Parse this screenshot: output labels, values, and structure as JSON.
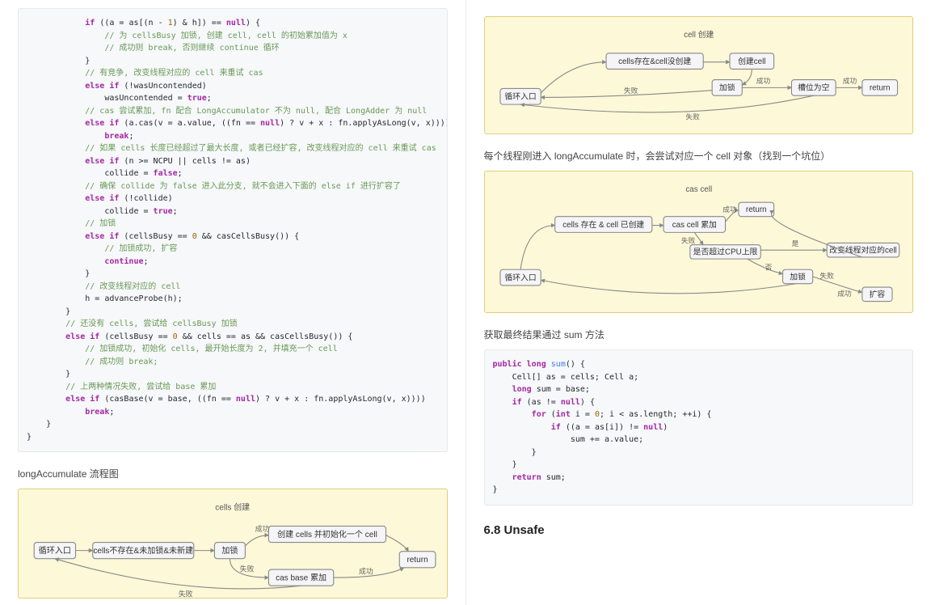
{
  "left": {
    "code1": {
      "tokens": [
        {
          "indent": 3,
          "parts": [
            {
              "t": "kw",
              "v": "if"
            },
            {
              "t": "",
              "v": " ((a = as[(n - "
            },
            {
              "t": "num",
              "v": "1"
            },
            {
              "t": "",
              "v": ") & h]) == "
            },
            {
              "t": "kw",
              "v": "null"
            },
            {
              "t": "",
              "v": ") {"
            }
          ]
        },
        {
          "indent": 4,
          "parts": [
            {
              "t": "cm",
              "v": "// 为 cellsBusy 加锁, 创建 cell, cell 的初始累加值为 x"
            }
          ]
        },
        {
          "indent": 4,
          "parts": [
            {
              "t": "cm",
              "v": "// 成功则 break, 否则继续 continue 循环"
            }
          ]
        },
        {
          "indent": 3,
          "parts": [
            {
              "t": "",
              "v": "}"
            }
          ]
        },
        {
          "indent": 3,
          "parts": [
            {
              "t": "cm",
              "v": "// 有竞争, 改变线程对应的 cell 来重试 cas"
            }
          ]
        },
        {
          "indent": 3,
          "parts": [
            {
              "t": "kw",
              "v": "else if"
            },
            {
              "t": "",
              "v": " (!wasUncontended)"
            }
          ]
        },
        {
          "indent": 4,
          "parts": [
            {
              "t": "",
              "v": "wasUncontended = "
            },
            {
              "t": "kw",
              "v": "true"
            },
            {
              "t": "",
              "v": ";"
            }
          ]
        },
        {
          "indent": 3,
          "parts": [
            {
              "t": "cm",
              "v": "// cas 尝试累加, fn 配合 LongAccumulator 不为 null, 配合 LongAdder 为 null"
            }
          ]
        },
        {
          "indent": 3,
          "parts": [
            {
              "t": "kw",
              "v": "else if"
            },
            {
              "t": "",
              "v": " (a.cas(v = a.value, ((fn == "
            },
            {
              "t": "kw",
              "v": "null"
            },
            {
              "t": "",
              "v": ") ? v + x : fn.applyAsLong(v, x))))"
            }
          ]
        },
        {
          "indent": 4,
          "parts": [
            {
              "t": "kw",
              "v": "break"
            },
            {
              "t": "",
              "v": ";"
            }
          ]
        },
        {
          "indent": 3,
          "parts": [
            {
              "t": "cm",
              "v": "// 如果 cells 长度已经超过了最大长度, 或者已经扩容, 改变线程对应的 cell 来重试 cas"
            }
          ]
        },
        {
          "indent": 3,
          "parts": [
            {
              "t": "kw",
              "v": "else if"
            },
            {
              "t": "",
              "v": " (n >= NCPU || cells != as)"
            }
          ]
        },
        {
          "indent": 4,
          "parts": [
            {
              "t": "",
              "v": "collide = "
            },
            {
              "t": "kw",
              "v": "false"
            },
            {
              "t": "",
              "v": ";"
            }
          ]
        },
        {
          "indent": 3,
          "parts": [
            {
              "t": "cm",
              "v": "// 确保 collide 为 false 进入此分支, 就不会进入下面的 else if 进行扩容了"
            }
          ]
        },
        {
          "indent": 3,
          "parts": [
            {
              "t": "kw",
              "v": "else if"
            },
            {
              "t": "",
              "v": " (!collide)"
            }
          ]
        },
        {
          "indent": 4,
          "parts": [
            {
              "t": "",
              "v": "collide = "
            },
            {
              "t": "kw",
              "v": "true"
            },
            {
              "t": "",
              "v": ";"
            }
          ]
        },
        {
          "indent": 3,
          "parts": [
            {
              "t": "cm",
              "v": "// 加锁"
            }
          ]
        },
        {
          "indent": 3,
          "parts": [
            {
              "t": "kw",
              "v": "else if"
            },
            {
              "t": "",
              "v": " (cellsBusy == "
            },
            {
              "t": "num",
              "v": "0"
            },
            {
              "t": "",
              "v": " && casCellsBusy()) {"
            }
          ]
        },
        {
          "indent": 4,
          "parts": [
            {
              "t": "cm",
              "v": "// 加锁成功, 扩容"
            }
          ]
        },
        {
          "indent": 4,
          "parts": [
            {
              "t": "kw",
              "v": "continue"
            },
            {
              "t": "",
              "v": ";"
            }
          ]
        },
        {
          "indent": 3,
          "parts": [
            {
              "t": "",
              "v": "}"
            }
          ]
        },
        {
          "indent": 3,
          "parts": [
            {
              "t": "cm",
              "v": "// 改变线程对应的 cell"
            }
          ]
        },
        {
          "indent": 3,
          "parts": [
            {
              "t": "",
              "v": "h = advanceProbe(h);"
            }
          ]
        },
        {
          "indent": 2,
          "parts": [
            {
              "t": "",
              "v": "}"
            }
          ]
        },
        {
          "indent": 2,
          "parts": [
            {
              "t": "cm",
              "v": "// 还没有 cells, 尝试给 cellsBusy 加锁"
            }
          ]
        },
        {
          "indent": 2,
          "parts": [
            {
              "t": "kw",
              "v": "else if"
            },
            {
              "t": "",
              "v": " (cellsBusy == "
            },
            {
              "t": "num",
              "v": "0"
            },
            {
              "t": "",
              "v": " && cells == as && casCellsBusy()) {"
            }
          ]
        },
        {
          "indent": 3,
          "parts": [
            {
              "t": "cm",
              "v": "// 加锁成功, 初始化 cells, 最开始长度为 2, 并填充一个 cell"
            }
          ]
        },
        {
          "indent": 3,
          "parts": [
            {
              "t": "cm",
              "v": "// 成功则 break;"
            }
          ]
        },
        {
          "indent": 2,
          "parts": [
            {
              "t": "",
              "v": "}"
            }
          ]
        },
        {
          "indent": 2,
          "parts": [
            {
              "t": "cm",
              "v": "// 上两种情况失败, 尝试给 base 累加"
            }
          ]
        },
        {
          "indent": 2,
          "parts": [
            {
              "t": "kw",
              "v": "else if"
            },
            {
              "t": "",
              "v": " (casBase(v = base, ((fn == "
            },
            {
              "t": "kw",
              "v": "null"
            },
            {
              "t": "",
              "v": ") ? v + x : fn.applyAsLong(v, x))))"
            }
          ]
        },
        {
          "indent": 3,
          "parts": [
            {
              "t": "kw",
              "v": "break"
            },
            {
              "t": "",
              "v": ";"
            }
          ]
        },
        {
          "indent": 1,
          "parts": [
            {
              "t": "",
              "v": "}"
            }
          ]
        },
        {
          "indent": 0,
          "parts": [
            {
              "t": "",
              "v": "}"
            }
          ]
        }
      ]
    },
    "caption1": "longAccumulate 流程图",
    "flow1": {
      "title": "cells 创建",
      "nodes": {
        "entry": "循环入口",
        "cond": "cells不存在&未加锁&未新建",
        "lock": "加锁",
        "create": "创建 cells 并初始化一个 cell",
        "cas": "cas base 累加",
        "ret": "return"
      },
      "edges": {
        "succ": "成功",
        "fail": "失败"
      }
    }
  },
  "right": {
    "flow2": {
      "title": "cell 创建",
      "nodes": {
        "entry": "循环入口",
        "cond": "cells存在&cell没创建",
        "create": "创建cell",
        "lock": "加锁",
        "empty": "槽位为空",
        "ret": "return"
      },
      "edges": {
        "succ": "成功",
        "fail": "失败"
      }
    },
    "caption2": "每个线程刚进入 longAccumulate 时，会尝试对应一个 cell 对象（找到一个坑位）",
    "flow3": {
      "title": "cas cell",
      "nodes": {
        "entry": "循环入口",
        "cond": "cells 存在 & cell 已创建",
        "cas": "cas cell 累加",
        "ret": "return",
        "cpu": "是否超过CPU上限",
        "change": "改变线程对应的cell",
        "lock": "加锁",
        "expand": "扩容"
      },
      "edges": {
        "succ": "成功",
        "fail": "失败",
        "yes": "是",
        "no": "否"
      }
    },
    "caption3": "获取最终结果通过 sum 方法",
    "code2": {
      "tokens": [
        {
          "indent": 0,
          "parts": [
            {
              "t": "kw",
              "v": "public"
            },
            {
              "t": "",
              "v": " "
            },
            {
              "t": "kw",
              "v": "long"
            },
            {
              "t": "",
              "v": " "
            },
            {
              "t": "fn",
              "v": "sum"
            },
            {
              "t": "",
              "v": "() {"
            }
          ]
        },
        {
          "indent": 1,
          "parts": [
            {
              "t": "",
              "v": "Cell[] as = cells; Cell a;"
            }
          ]
        },
        {
          "indent": 1,
          "parts": [
            {
              "t": "kw",
              "v": "long"
            },
            {
              "t": "",
              "v": " sum = base;"
            }
          ]
        },
        {
          "indent": 1,
          "parts": [
            {
              "t": "kw",
              "v": "if"
            },
            {
              "t": "",
              "v": " (as != "
            },
            {
              "t": "kw",
              "v": "null"
            },
            {
              "t": "",
              "v": ") {"
            }
          ]
        },
        {
          "indent": 2,
          "parts": [
            {
              "t": "kw",
              "v": "for"
            },
            {
              "t": "",
              "v": " ("
            },
            {
              "t": "kw",
              "v": "int"
            },
            {
              "t": "",
              "v": " i = "
            },
            {
              "t": "num",
              "v": "0"
            },
            {
              "t": "",
              "v": "; i < as.length; ++i) {"
            }
          ]
        },
        {
          "indent": 3,
          "parts": [
            {
              "t": "kw",
              "v": "if"
            },
            {
              "t": "",
              "v": " ((a = as[i]) != "
            },
            {
              "t": "kw",
              "v": "null"
            },
            {
              "t": "",
              "v": ")"
            }
          ]
        },
        {
          "indent": 4,
          "parts": [
            {
              "t": "",
              "v": "sum += a.value;"
            }
          ]
        },
        {
          "indent": 2,
          "parts": [
            {
              "t": "",
              "v": "}"
            }
          ]
        },
        {
          "indent": 1,
          "parts": [
            {
              "t": "",
              "v": "}"
            }
          ]
        },
        {
          "indent": 1,
          "parts": [
            {
              "t": "kw",
              "v": "return"
            },
            {
              "t": "",
              "v": " sum;"
            }
          ]
        },
        {
          "indent": 0,
          "parts": [
            {
              "t": "",
              "v": "}"
            }
          ]
        }
      ]
    },
    "heading": "6.8 Unsafe"
  }
}
